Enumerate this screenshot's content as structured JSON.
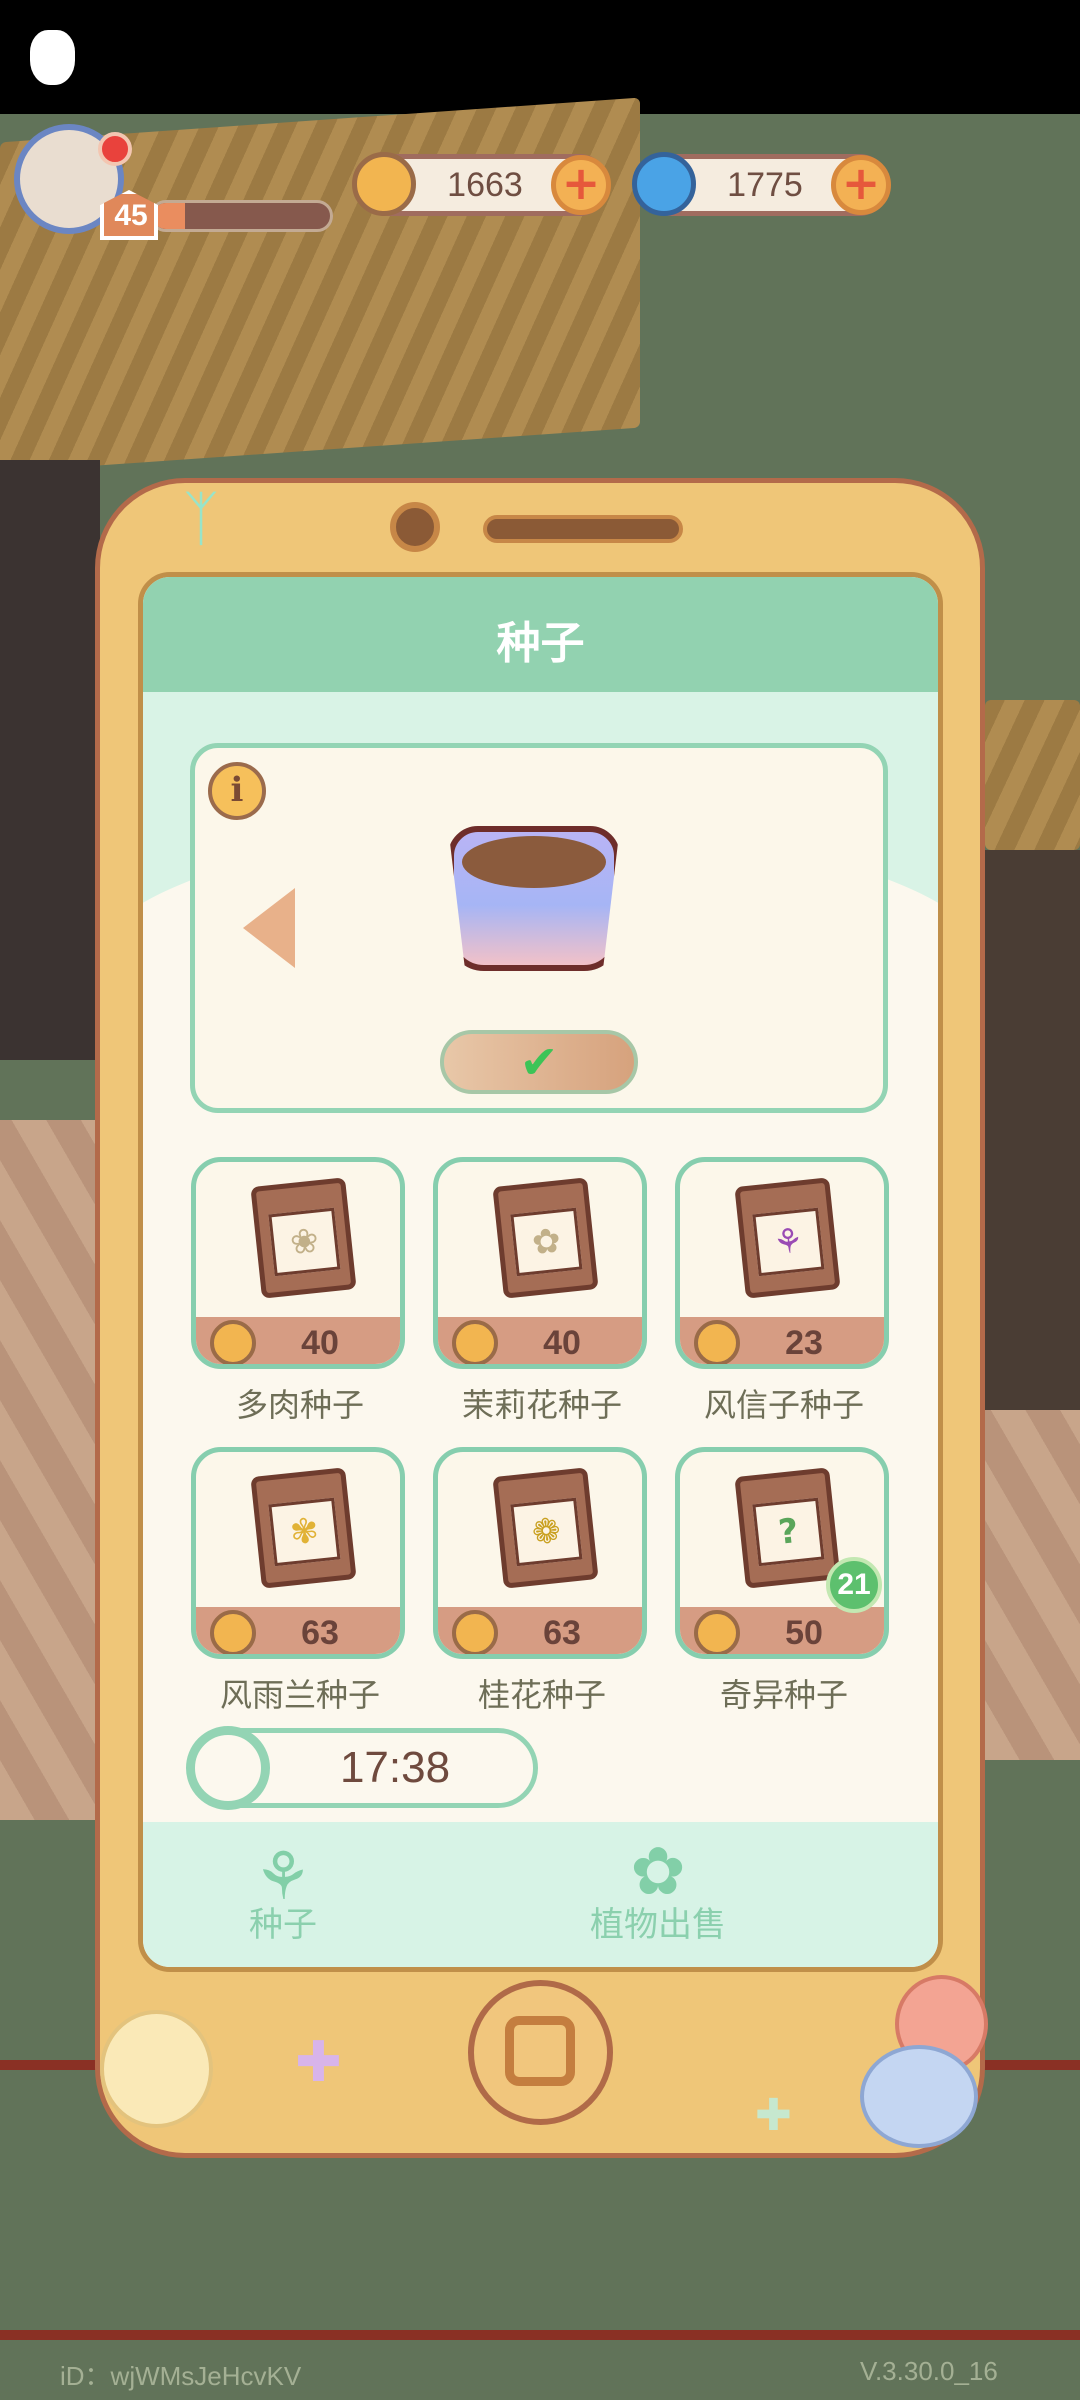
{
  "hud": {
    "level": "45",
    "xp_progress": 0.18,
    "coins": "1663",
    "gems": "1775"
  },
  "seed_panel": {
    "title": "种子",
    "info_symbol": "i",
    "confirm_symbol": "✔",
    "seeds": [
      {
        "name": "多肉种子",
        "price": "40",
        "icon": "succulent-flower-icon"
      },
      {
        "name": "茉莉花种子",
        "price": "40",
        "icon": "jasmine-flower-icon"
      },
      {
        "name": "风信子种子",
        "price": "23",
        "icon": "hyacinth-flower-icon"
      },
      {
        "name": "风雨兰种子",
        "price": "63",
        "icon": "rain-lily-flower-icon"
      },
      {
        "name": "桂花种子",
        "price": "63",
        "icon": "osmanthus-flower-icon"
      },
      {
        "name": "奇异种子",
        "price": "50",
        "icon": "mystery-question-icon",
        "badge": "21"
      }
    ],
    "timer": "17:38",
    "tabs": [
      {
        "label": "种子",
        "icon": "sprout-icon"
      },
      {
        "label": "植物出售",
        "icon": "flower-icon"
      }
    ]
  },
  "footer": {
    "id_text": "iD：wjWMsJeHcvKV",
    "version": "V.3.30.0_16"
  },
  "colors": {
    "accent_green": "#92d2b0",
    "phone_body": "#efc678",
    "price_bar": "#d69c83"
  }
}
